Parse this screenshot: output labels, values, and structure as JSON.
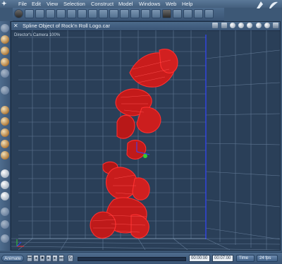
{
  "menubar": {
    "items": [
      "File",
      "Edit",
      "View",
      "Selection",
      "Construct",
      "Model",
      "Windows",
      "Web",
      "Help"
    ]
  },
  "viewport": {
    "title": "Spline Object of Rock'n Roll Logo.car",
    "camera_label": "Director's Camera 100%"
  },
  "playback": {
    "animate_label": "Animate",
    "time_start": "00:00:00",
    "time_end": "00:07:00",
    "time_mode": "Time",
    "fps": "24 fps"
  },
  "colors": {
    "wireframe": "#ff2020",
    "axis_blue": "#3344ff",
    "axis_green": "#33cc33",
    "grid": "#7a90aa"
  }
}
